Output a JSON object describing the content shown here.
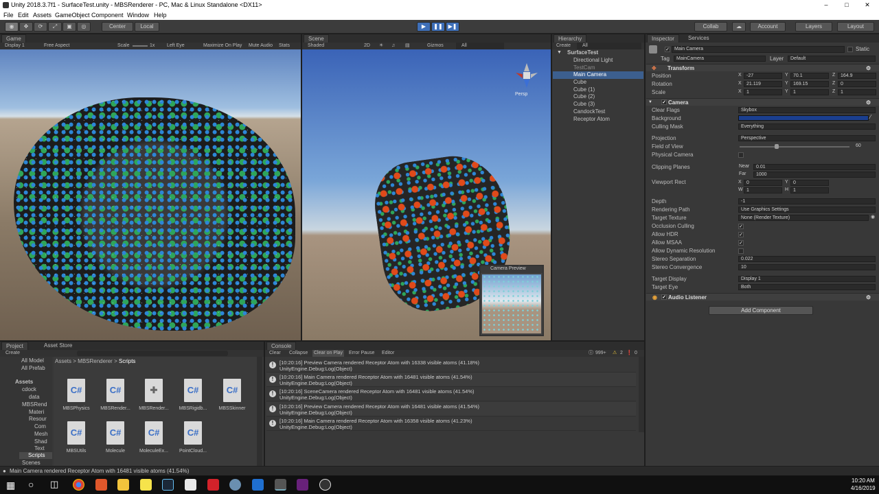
{
  "window": {
    "title": "Unity 2018.3.7f1 - SurfaceTest.unity - MBSRenderer - PC, Mac & Linux Standalone <DX11>"
  },
  "menu": [
    "File",
    "Edit",
    "Assets",
    "GameObject",
    "Component",
    "Window",
    "Help"
  ],
  "toolbar": {
    "center": "Center",
    "local": "Local",
    "collab": "Collab",
    "account": "Account",
    "layers": "Layers",
    "layout": "Layout"
  },
  "game": {
    "tab": "Game",
    "display": "Display 1",
    "aspect": "Free Aspect",
    "scale": "Scale",
    "scale_value": "1x",
    "left_eye": "Left Eye",
    "maximize": "Maximize On Play",
    "mute": "Mute Audio",
    "stats": "Stats"
  },
  "scene": {
    "tab": "Scene",
    "shaded": "Shaded",
    "mode2d": "2D",
    "gizmos": "Gizmos",
    "search": "All",
    "persp": "Persp",
    "preview_title": "Camera Preview"
  },
  "hierarchy": {
    "tab": "Hierarchy",
    "create": "Create",
    "search": "All",
    "root": "SurfaceTest",
    "items": [
      "Directional Light",
      "TestCam",
      "Main Camera",
      "Cube",
      "Cube (1)",
      "Cube (2)",
      "Cube (3)",
      "CandockTest",
      "Receptor Atom"
    ],
    "selected": "Main Camera"
  },
  "inspector": {
    "tab": "Inspector",
    "services": "Services",
    "name": "Main Camera",
    "static": "Static",
    "tag_label": "Tag",
    "tag": "MainCamera",
    "layer_label": "Layer",
    "layer": "Default",
    "transform": {
      "title": "Transform",
      "position": "Position",
      "rotation": "Rotation",
      "scale": "Scale",
      "pos": [
        "-27",
        "70.1",
        "164.9"
      ],
      "rot": [
        "21.119",
        "169.15",
        "0"
      ],
      "scl": [
        "1",
        "1",
        "1"
      ]
    },
    "camera": {
      "title": "Camera",
      "clear_flags": "Clear Flags",
      "clear_flags_v": "Skybox",
      "background": "Background",
      "background_color": "#1b3f8f",
      "culling": "Culling Mask",
      "culling_v": "Everything",
      "projection": "Projection",
      "projection_v": "Perspective",
      "fov": "Field of View",
      "fov_v": "60",
      "physical": "Physical Camera",
      "clipping": "Clipping Planes",
      "near_l": "Near",
      "near": "0.01",
      "far_l": "Far",
      "far": "1000",
      "viewport": "Viewport Rect",
      "vx": "0",
      "vy": "0",
      "vw": "1",
      "vh": "1",
      "depth": "Depth",
      "depth_v": "-1",
      "rendering_path": "Rendering Path",
      "rendering_path_v": "Use Graphics Settings",
      "target_texture": "Target Texture",
      "target_texture_v": "None (Render Texture)",
      "occlusion": "Occlusion Culling",
      "hdr": "Allow HDR",
      "msaa": "Allow MSAA",
      "dynres": "Allow Dynamic Resolution",
      "stereo_sep": "Stereo Separation",
      "stereo_sep_v": "0.022",
      "stereo_conv": "Stereo Convergence",
      "stereo_conv_v": "10",
      "target_display": "Target Display",
      "target_display_v": "Display 1",
      "target_eye": "Target Eye",
      "target_eye_v": "Both"
    },
    "audio": "Audio Listener",
    "add_component": "Add Component"
  },
  "project": {
    "tab": "Project",
    "asset_store": "Asset Store",
    "create": "Create",
    "breadcrumb": [
      "Assets",
      "MBSRenderer",
      "Scripts"
    ],
    "tree": [
      "All Model",
      "All Prefab",
      "Assets",
      "cdock",
      "data",
      "MBSRend",
      "Materi",
      "Resour",
      "Com",
      "Mesh",
      "Shad",
      "Text",
      "Scripts",
      "Scenes"
    ],
    "files": [
      "MBSPhysics",
      "MBSRender...",
      "MBSRender...",
      "MBSRigidb...",
      "MBSSkinner",
      "MBSUtils",
      "Molecule",
      "MoleculeEx...",
      "PointCloud..."
    ],
    "cs_label": "C#"
  },
  "console": {
    "tab": "Console",
    "clear": "Clear",
    "collapse": "Collapse",
    "clear_on_play": "Clear on Play",
    "error_pause": "Error Pause",
    "editor": "Editor",
    "count_info": "999+",
    "count_warn": "2",
    "count_err": "0",
    "logs": [
      {
        "l1": "[10:20:16] Preview Camera rendered Receptor Atom with 16338 visible atoms (41.18%)",
        "l2": "UnityEngine.Debug:Log(Object)"
      },
      {
        "l1": "[10:20:16] Main Camera rendered Receptor Atom with 16481 visible atoms (41.54%)",
        "l2": "UnityEngine.Debug:Log(Object)"
      },
      {
        "l1": "[10:20:16] SceneCamera rendered Receptor Atom with 16481 visible atoms (41.54%)",
        "l2": "UnityEngine.Debug:Log(Object)"
      },
      {
        "l1": "[10:20:16] Preview Camera rendered Receptor Atom with 16481 visible atoms (41.54%)",
        "l2": "UnityEngine.Debug:Log(Object)"
      },
      {
        "l1": "[10:20:16] Main Camera rendered Receptor Atom with 16358 visible atoms (41.23%)",
        "l2": "UnityEngine.Debug:Log(Object)"
      }
    ]
  },
  "status": "Main Camera rendered Receptor Atom with 16481 visible atoms (41.54%)",
  "taskbar": {
    "time": "10:20 AM",
    "date": "4/16/2019"
  }
}
